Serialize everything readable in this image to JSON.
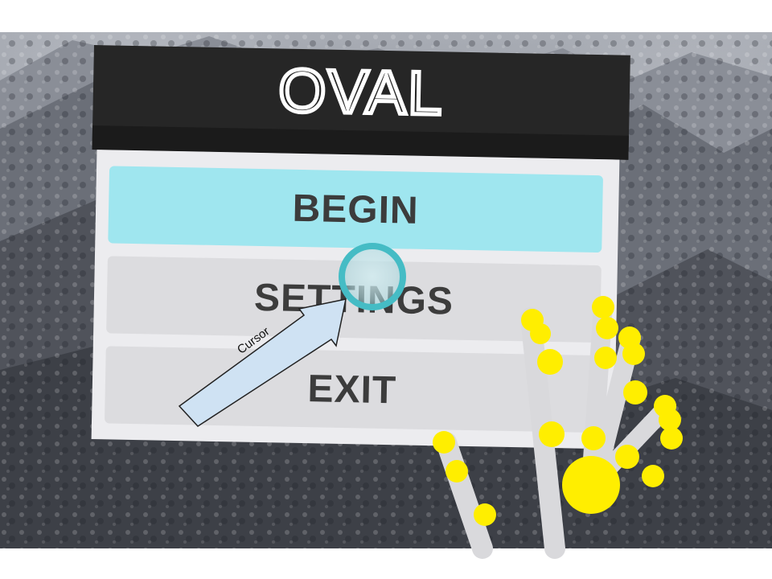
{
  "app": {
    "logo_text": "OVAL"
  },
  "menu": {
    "items": [
      {
        "label": "BEGIN",
        "state": "hovered"
      },
      {
        "label": "SETTINGS",
        "state": "normal"
      },
      {
        "label": "EXIT",
        "state": "normal"
      }
    ]
  },
  "annotation": {
    "label": "Cursor"
  },
  "colors": {
    "panel_header": "#262626",
    "panel_body": "#ececef",
    "button_hover": "#9fe6ef",
    "button_normal": "#dcdcdf",
    "cursor_ring": "#45bcc5",
    "hand_joints": "#ffee00",
    "annotation_fill": "#cfe2f3"
  },
  "icons": {
    "cursor": "ring-cursor-icon",
    "hand": "tracked-hand-icon",
    "arrow": "callout-arrow-icon"
  }
}
